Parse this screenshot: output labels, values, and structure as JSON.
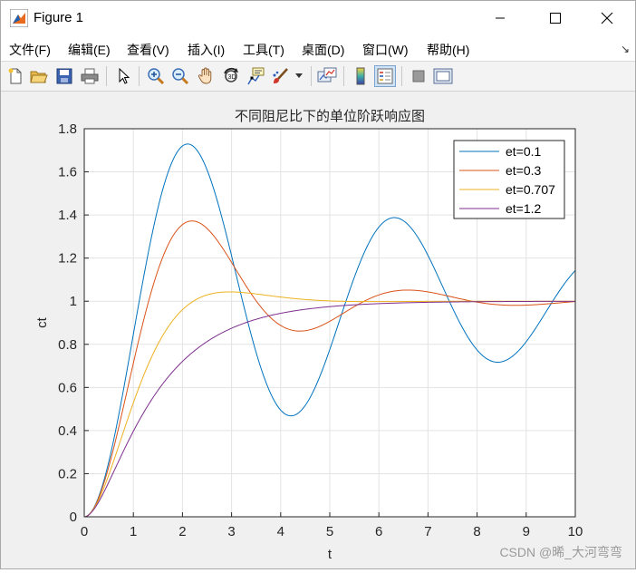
{
  "window": {
    "title": "Figure 1",
    "controls": [
      "minimize",
      "maximize",
      "close"
    ]
  },
  "menubar": {
    "items": [
      "文件(F)",
      "编辑(E)",
      "查看(V)",
      "插入(I)",
      "工具(T)",
      "桌面(D)",
      "窗口(W)",
      "帮助(H)"
    ],
    "overflow_glyph": "↘"
  },
  "toolbar": {
    "icons": [
      "new-figure-icon",
      "open-file-icon",
      "save-icon",
      "print-icon",
      "edit-plot-arrow-icon",
      "zoom-in-icon",
      "zoom-out-icon",
      "pan-hand-icon",
      "rotate-3d-icon",
      "data-cursor-icon",
      "brush-icon",
      "link-plot-icon",
      "colorbar-icon",
      "legend-icon",
      "hide-plot-tools-icon",
      "show-plot-tools-icon"
    ]
  },
  "chart_data": {
    "type": "line",
    "title": "不同阻尼比下的单位阶跃响应图",
    "xlabel": "t",
    "ylabel": "ct",
    "xlim": [
      0,
      10
    ],
    "ylim": [
      0,
      1.8
    ],
    "x_ticks": [
      "0",
      "1",
      "2",
      "3",
      "4",
      "5",
      "6",
      "7",
      "8",
      "9",
      "10"
    ],
    "y_ticks": [
      "0",
      "0.2",
      "0.4",
      "0.6",
      "0.8",
      "1",
      "1.2",
      "1.4",
      "1.6",
      "1.8"
    ],
    "grid": true,
    "legend_position": "top-right",
    "wn": 1.5,
    "series": [
      {
        "name": "et=0.1",
        "zeta": 0.1,
        "color": "#0072BD"
      },
      {
        "name": "et=0.3",
        "zeta": 0.3,
        "color": "#D95319"
      },
      {
        "name": "et=0.707",
        "zeta": 0.707,
        "color": "#EDB120"
      },
      {
        "name": "et=1.2",
        "zeta": 1.2,
        "color": "#7E2F8E"
      }
    ]
  },
  "watermark": "CSDN @晞_大河弯弯"
}
